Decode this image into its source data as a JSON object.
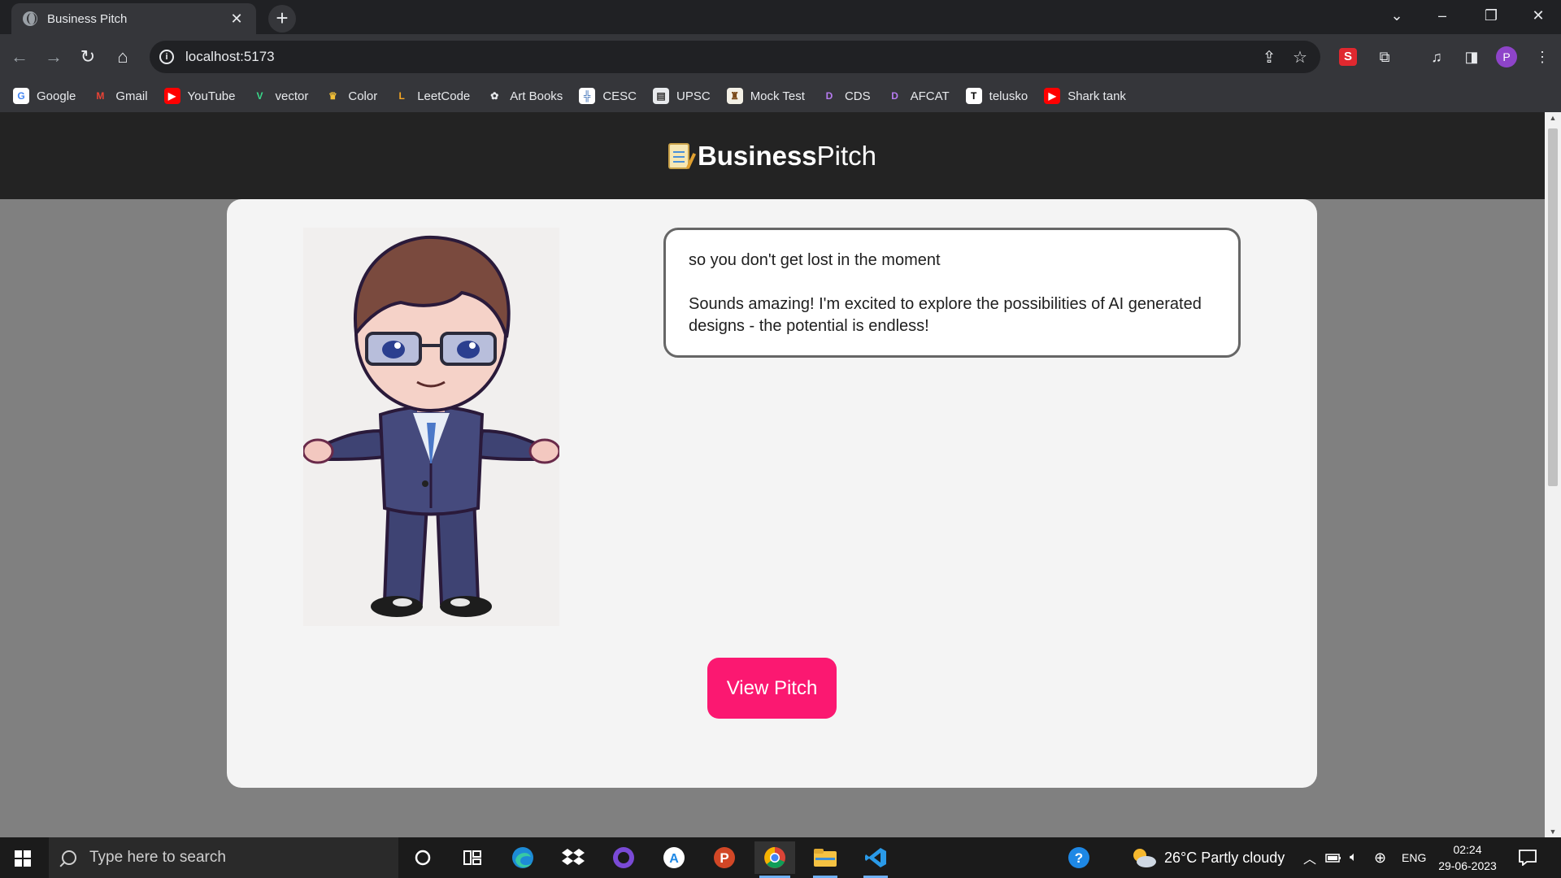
{
  "browser": {
    "tab_title": "Business Pitch",
    "tab_close": "✕",
    "new_tab": "+",
    "url": "localhost:5173",
    "window_controls": {
      "dropdown": "⌄",
      "minimize": "–",
      "restore": "❐",
      "close": "✕"
    },
    "nav": {
      "back": "←",
      "forward": "→",
      "reload": "↻",
      "home": "⌂"
    },
    "avatar_letter": "P",
    "extension_letter": "S"
  },
  "bookmarks": [
    {
      "label": "Google",
      "icon": "google-icon",
      "color": "#ffffff",
      "glyph": "G",
      "fg": "#4285f4"
    },
    {
      "label": "Gmail",
      "icon": "gmail-icon",
      "color": "transparent",
      "glyph": "M",
      "fg": "#ea4335"
    },
    {
      "label": "YouTube",
      "icon": "youtube-icon",
      "color": "#ff0000",
      "glyph": "▶",
      "fg": "#ffffff"
    },
    {
      "label": "vector",
      "icon": "vector-icon",
      "color": "transparent",
      "glyph": "V",
      "fg": "#39d98a"
    },
    {
      "label": "Color",
      "icon": "color-icon",
      "color": "transparent",
      "glyph": "♛",
      "fg": "#f2c037"
    },
    {
      "label": "LeetCode",
      "icon": "leetcode-icon",
      "color": "transparent",
      "glyph": "L",
      "fg": "#f5a623"
    },
    {
      "label": "Art Books",
      "icon": "art-books-icon",
      "color": "transparent",
      "glyph": "✿",
      "fg": "#e8eaed"
    },
    {
      "label": "CESC",
      "icon": "cesc-icon",
      "color": "#ffffff",
      "glyph": "╬",
      "fg": "#3b6fb6"
    },
    {
      "label": "UPSC",
      "icon": "upsc-icon",
      "color": "#e8eaed",
      "glyph": "▤",
      "fg": "#333333"
    },
    {
      "label": "Mock Test",
      "icon": "mock-test-icon",
      "color": "#f3f0e6",
      "glyph": "♜",
      "fg": "#7a4a1a"
    },
    {
      "label": "CDS",
      "icon": "cds-icon",
      "color": "transparent",
      "glyph": "D",
      "fg": "#b67bf0"
    },
    {
      "label": "AFCAT",
      "icon": "afcat-icon",
      "color": "transparent",
      "glyph": "D",
      "fg": "#b67bf0"
    },
    {
      "label": "telusko",
      "icon": "telusko-icon",
      "color": "#ffffff",
      "glyph": "T",
      "fg": "#000000"
    },
    {
      "label": "Shark tank",
      "icon": "shark-tank-icon",
      "color": "#ff0000",
      "glyph": "▶",
      "fg": "#ffffff"
    }
  ],
  "page": {
    "brand_bold": "Business",
    "brand_light": "Pitch",
    "character_alt": "Chibi businessman character",
    "bubble_line_1": "so you don't get lost in the moment",
    "bubble_line_2": "Sounds amazing! I'm excited to explore the possibilities of AI generated designs - the potential is endless!",
    "button_label": "View Pitch",
    "accent_color": "#fb1871"
  },
  "taskbar": {
    "search_placeholder": "Type here to search",
    "weather": "26°C  Partly cloudy",
    "language": "ENG",
    "time": "02:24",
    "date": "29-06-2023"
  }
}
